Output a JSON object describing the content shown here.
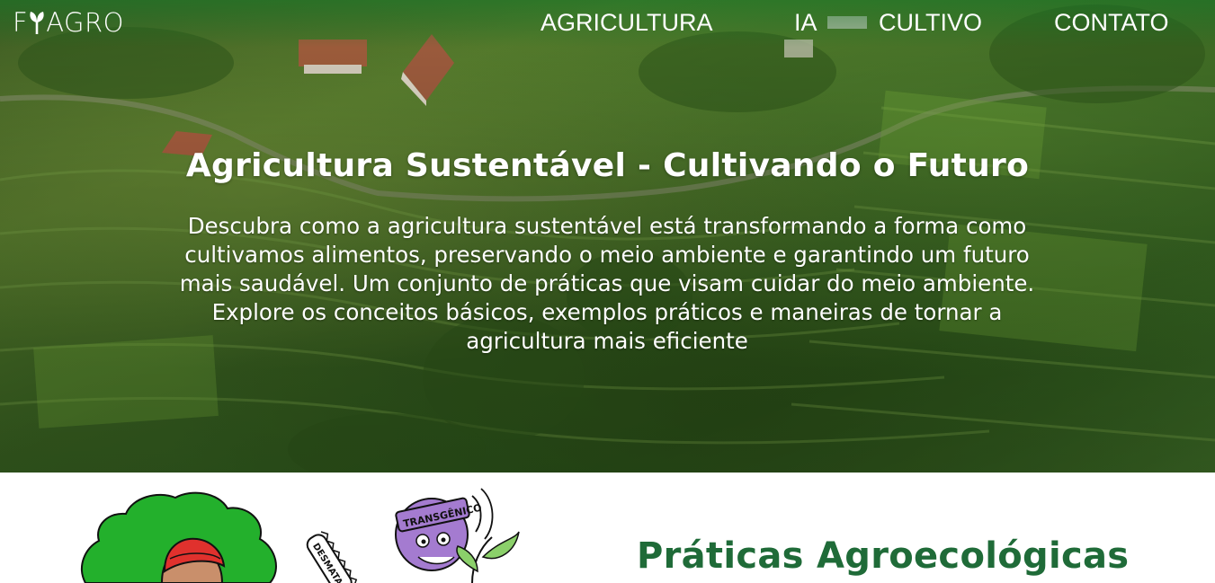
{
  "logo": {
    "prefix": "F",
    "suffix": "AGRO"
  },
  "nav": {
    "items": [
      {
        "label": "AGRICULTURA"
      },
      {
        "label": "IA"
      },
      {
        "label": "CULTIVO"
      },
      {
        "label": "CONTATO"
      }
    ]
  },
  "hero": {
    "title": "Agricultura Sustentável - Cultivando o Futuro",
    "description": "Descubra como a agricultura sustentável está transformando a forma como cultivamos alimentos, preservando o meio ambiente e garantindo um futuro mais saudável. Um conjunto de práticas que visam cuidar do meio ambiente. Explore os conceitos básicos, exemplos práticos e maneiras de tornar a agricultura mais eficiente"
  },
  "section": {
    "title": "Práticas Agroecológicas",
    "illustration_labels": {
      "sign": "TRANSGÊNICO",
      "saw": "DESMATA"
    }
  },
  "colors": {
    "brand_green": "#1f6b38",
    "nav_text": "#ffffff"
  }
}
